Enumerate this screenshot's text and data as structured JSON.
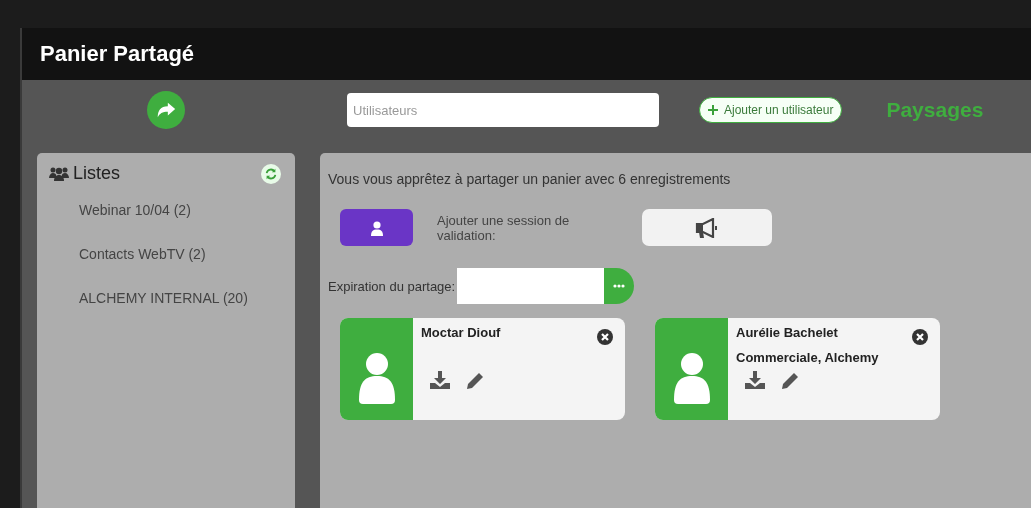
{
  "window": {
    "title": "Panier Partagé"
  },
  "toolbar": {
    "search": {
      "placeholder": "Utilisateurs"
    },
    "add_button": "Ajouter un utilisateur",
    "heading": "Paysages"
  },
  "lists": {
    "title": "Listes",
    "items": [
      {
        "label": "Webinar 10/04 (2)"
      },
      {
        "label": "Contacts WebTV (2)"
      },
      {
        "label": "ALCHEMY INTERNAL (20)"
      }
    ]
  },
  "share": {
    "message": "Vous vous apprêtez à partager un panier avec 6 enregistrements",
    "validation_label": "Ajouter une session de validation:",
    "expiration_label": "Expiration du partage:",
    "users": [
      {
        "name": "Moctar Diouf"
      },
      {
        "name": "Aurélie Bachelet",
        "role": "Commerciale, Alchemy"
      }
    ]
  }
}
